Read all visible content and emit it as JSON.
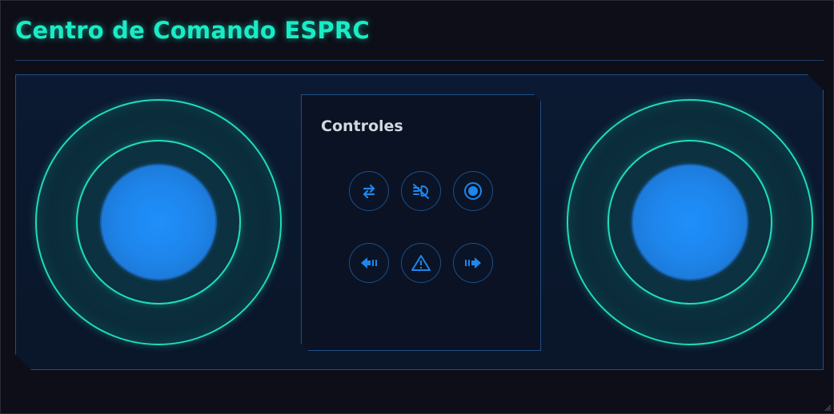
{
  "header": {
    "title": "Centro de Comando ESPRC"
  },
  "controls": {
    "title": "Controles",
    "buttons": [
      {
        "name": "swap-direction",
        "icon": "arrows-swap-icon"
      },
      {
        "name": "lights-off",
        "icon": "headlight-off-icon"
      },
      {
        "name": "record",
        "icon": "record-icon"
      },
      {
        "name": "left-signal",
        "icon": "turn-left-signal-icon"
      },
      {
        "name": "hazard",
        "icon": "hazard-warning-icon"
      },
      {
        "name": "right-signal",
        "icon": "turn-right-signal-icon"
      }
    ]
  },
  "theme": {
    "accent": "#19ecc6",
    "ring": "#1fdcbc",
    "knob": "#1e86ec",
    "icon": "#1e86ec",
    "border": "#1f4f86",
    "background": "#0d0e18"
  }
}
